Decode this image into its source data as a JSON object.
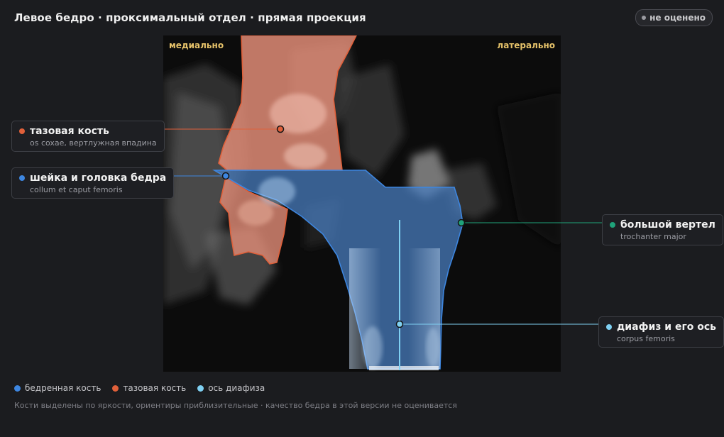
{
  "header": {
    "title": "Левое бедро · проксимальный отдел · прямая проекция",
    "status_badge": "не оценено"
  },
  "viewer": {
    "orientation_left": "медиально",
    "orientation_right": "латерально"
  },
  "callouts": [
    {
      "name": "тазовая кость",
      "latin": "os coxae, вертлужная впадина",
      "color": "#e0603a"
    },
    {
      "name": "шейка и головка бедра",
      "latin": "collum et caput femoris",
      "color": "#3d86e0"
    },
    {
      "name": "большой вертел",
      "latin": "trochanter major",
      "color": "#1fa37a"
    },
    {
      "name": "диафиз и его ось",
      "latin": "corpus femoris",
      "color": "#7fd0f2"
    }
  ],
  "legend": [
    {
      "label": "бедренная кость",
      "color": "#3d86e0"
    },
    {
      "label": "тазовая кость",
      "color": "#e0603a"
    },
    {
      "label": "ось диафиза",
      "color": "#7fd0f2"
    }
  ],
  "footnote": "Кости выделены по яркости, ориентиры приблизительные · качество бедра в этой версии не оценивается",
  "colors": {
    "background": "#1b1c1f",
    "orientation_label": "#e7c36a",
    "femur_overlay": "#3d86e0",
    "pelvis_overlay": "#e0603a",
    "shaft_axis": "#7fd0f2",
    "trochanter_marker": "#1fa37a"
  }
}
